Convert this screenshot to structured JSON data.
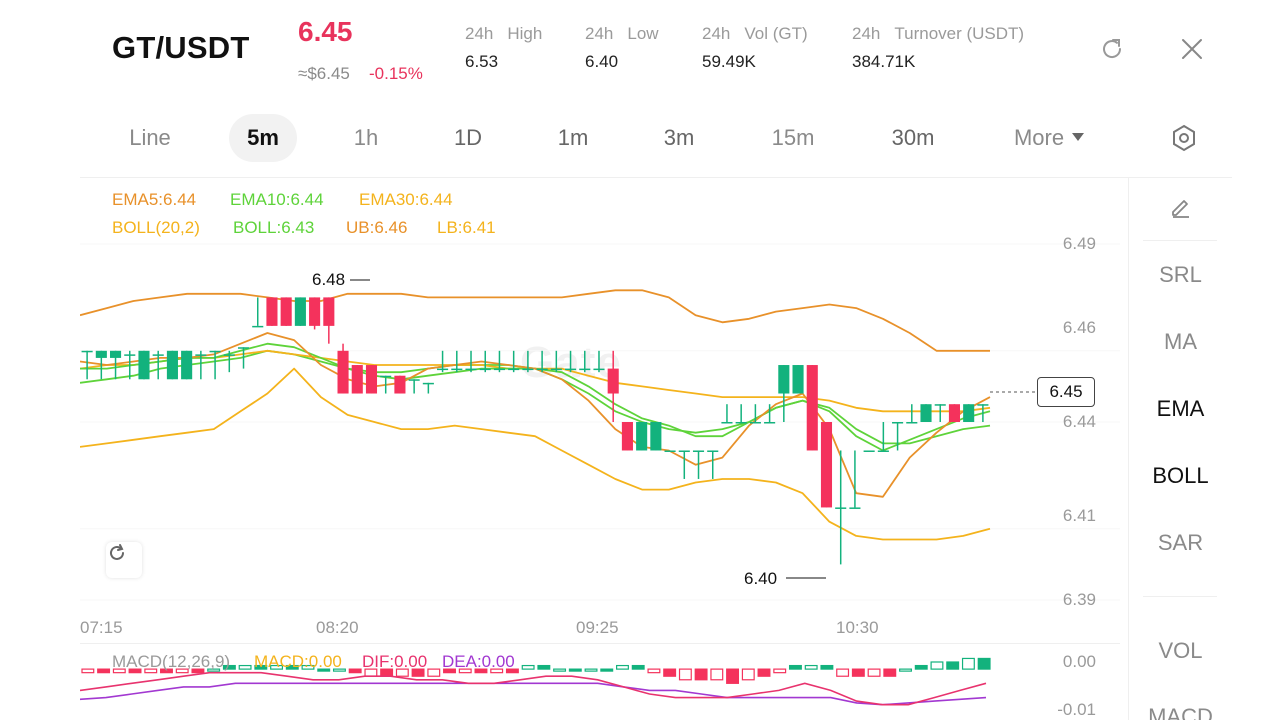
{
  "header": {
    "pair": "GT/USDT",
    "last_price": "6.45",
    "fiat_price": "≈$6.45",
    "change_pct": "-0.15%",
    "stats": [
      {
        "prefix": "24h",
        "label": "High",
        "value": "6.53"
      },
      {
        "prefix": "24h",
        "label": "Low",
        "value": "6.40"
      },
      {
        "prefix": "24h",
        "label": "Vol (GT)",
        "value": "59.49K"
      },
      {
        "prefix": "24h",
        "label": "Turnover (USDT)",
        "value": "384.71K"
      }
    ]
  },
  "timeframes": {
    "items": [
      "Line",
      "5m",
      "1h",
      "1D",
      "1m",
      "3m",
      "15m",
      "30m"
    ],
    "active": "5m",
    "more_label": "More"
  },
  "indicators": {
    "ema": {
      "ema5": "EMA5:6.44",
      "ema10": "EMA10:6.44",
      "ema30": "EMA30:6.44"
    },
    "boll": {
      "params": "BOLL(20,2)",
      "mid": "BOLL:6.43",
      "ub": "UB:6.46",
      "lb": "LB:6.41"
    },
    "macd": {
      "params": "MACD(12,26,9)",
      "macd": "MACD:0.00",
      "dif": "DIF:0.00",
      "dea": "DEA:0.00"
    }
  },
  "right_panel": {
    "items": [
      "SRL",
      "MA",
      "EMA",
      "BOLL",
      "SAR",
      "VOL",
      "MACD"
    ],
    "active": [
      "EMA",
      "BOLL"
    ]
  },
  "colors": {
    "up": "#13b27d",
    "down": "#f4325c",
    "ema5": "#e8912a",
    "ema10": "#5ed33a",
    "ema30": "#f4b31c",
    "boll_mid": "#5ed33a",
    "boll_ub": "#e8912a",
    "boll_lb": "#f4b31c",
    "dif": "#e8336e",
    "dea": "#a238d1"
  },
  "watermark": "Gate",
  "chart_data": {
    "type": "candlestick",
    "time_labels": [
      "07:15",
      "08:20",
      "09:25",
      "10:30"
    ],
    "y_ticks": [
      "6.49",
      "6.46",
      "6.44",
      "6.41",
      "6.39"
    ],
    "macd_ticks": [
      "0.00",
      "-0.01"
    ],
    "last_price": "6.45",
    "annotations": {
      "high": "6.48",
      "low": "6.40"
    },
    "candles": [
      {
        "o": 6.46,
        "c": 6.46,
        "h": 6.46,
        "l": 6.452
      },
      {
        "o": 6.458,
        "c": 6.46,
        "h": 6.46,
        "l": 6.452
      },
      {
        "o": 6.458,
        "c": 6.46,
        "h": 6.46,
        "l": 6.452
      },
      {
        "o": 6.459,
        "c": 6.459,
        "h": 6.46,
        "l": 6.452
      },
      {
        "o": 6.452,
        "c": 6.46,
        "h": 6.46,
        "l": 6.452
      },
      {
        "o": 6.459,
        "c": 6.459,
        "h": 6.46,
        "l": 6.452
      },
      {
        "o": 6.452,
        "c": 6.46,
        "h": 6.46,
        "l": 6.452
      },
      {
        "o": 6.452,
        "c": 6.46,
        "h": 6.46,
        "l": 6.452
      },
      {
        "o": 6.459,
        "c": 6.459,
        "h": 6.46,
        "l": 6.452
      },
      {
        "o": 6.46,
        "c": 6.46,
        "h": 6.46,
        "l": 6.452
      },
      {
        "o": 6.459,
        "c": 6.459,
        "h": 6.46,
        "l": 6.454
      },
      {
        "o": 6.461,
        "c": 6.461,
        "h": 6.461,
        "l": 6.455
      },
      {
        "o": 6.467,
        "c": 6.467,
        "h": 6.475,
        "l": 6.467
      },
      {
        "o": 6.475,
        "c": 6.467,
        "h": 6.475,
        "l": 6.467
      },
      {
        "o": 6.475,
        "c": 6.467,
        "h": 6.475,
        "l": 6.467
      },
      {
        "o": 6.467,
        "c": 6.475,
        "h": 6.475,
        "l": 6.467
      },
      {
        "o": 6.475,
        "c": 6.467,
        "h": 6.475,
        "l": 6.466
      },
      {
        "o": 6.475,
        "c": 6.467,
        "h": 6.475,
        "l": 6.462
      },
      {
        "o": 6.46,
        "c": 6.448,
        "h": 6.462,
        "l": 6.448
      },
      {
        "o": 6.456,
        "c": 6.448,
        "h": 6.456,
        "l": 6.448
      },
      {
        "o": 6.456,
        "c": 6.448,
        "h": 6.456,
        "l": 6.448
      },
      {
        "o": 6.453,
        "c": 6.453,
        "h": 6.453,
        "l": 6.448
      },
      {
        "o": 6.453,
        "c": 6.448,
        "h": 6.453,
        "l": 6.448
      },
      {
        "o": 6.452,
        "c": 6.452,
        "h": 6.452,
        "l": 6.448
      },
      {
        "o": 6.451,
        "c": 6.451,
        "h": 6.451,
        "l": 6.448
      },
      {
        "o": 6.455,
        "c": 6.455,
        "h": 6.46,
        "l": 6.454
      },
      {
        "o": 6.455,
        "c": 6.455,
        "h": 6.46,
        "l": 6.454
      },
      {
        "o": 6.455,
        "c": 6.455,
        "h": 6.46,
        "l": 6.454
      },
      {
        "o": 6.455,
        "c": 6.455,
        "h": 6.46,
        "l": 6.454
      },
      {
        "o": 6.455,
        "c": 6.455,
        "h": 6.46,
        "l": 6.454
      },
      {
        "o": 6.455,
        "c": 6.455,
        "h": 6.46,
        "l": 6.454
      },
      {
        "o": 6.455,
        "c": 6.455,
        "h": 6.46,
        "l": 6.454
      },
      {
        "o": 6.455,
        "c": 6.455,
        "h": 6.46,
        "l": 6.454
      },
      {
        "o": 6.455,
        "c": 6.455,
        "h": 6.46,
        "l": 6.454
      },
      {
        "o": 6.455,
        "c": 6.455,
        "h": 6.46,
        "l": 6.454
      },
      {
        "o": 6.455,
        "c": 6.455,
        "h": 6.46,
        "l": 6.454
      },
      {
        "o": 6.455,
        "c": 6.455,
        "h": 6.46,
        "l": 6.454
      },
      {
        "o": 6.455,
        "c": 6.448,
        "h": 6.46,
        "l": 6.44
      },
      {
        "o": 6.44,
        "c": 6.432,
        "h": 6.44,
        "l": 6.432
      },
      {
        "o": 6.432,
        "c": 6.44,
        "h": 6.44,
        "l": 6.432
      },
      {
        "o": 6.432,
        "c": 6.44,
        "h": 6.44,
        "l": 6.432
      },
      {
        "o": 6.432,
        "c": 6.432,
        "h": 6.432,
        "l": 6.432
      },
      {
        "o": 6.432,
        "c": 6.432,
        "h": 6.432,
        "l": 6.424
      },
      {
        "o": 6.432,
        "c": 6.432,
        "h": 6.432,
        "l": 6.424
      },
      {
        "o": 6.432,
        "c": 6.432,
        "h": 6.432,
        "l": 6.424
      },
      {
        "o": 6.44,
        "c": 6.44,
        "h": 6.445,
        "l": 6.44
      },
      {
        "o": 6.44,
        "c": 6.44,
        "h": 6.445,
        "l": 6.44
      },
      {
        "o": 6.44,
        "c": 6.44,
        "h": 6.445,
        "l": 6.44
      },
      {
        "o": 6.44,
        "c": 6.44,
        "h": 6.445,
        "l": 6.44
      },
      {
        "o": 6.448,
        "c": 6.456,
        "h": 6.456,
        "l": 6.44
      },
      {
        "o": 6.448,
        "c": 6.456,
        "h": 6.456,
        "l": 6.448
      },
      {
        "o": 6.456,
        "c": 6.432,
        "h": 6.456,
        "l": 6.432
      },
      {
        "o": 6.44,
        "c": 6.416,
        "h": 6.44,
        "l": 6.416
      },
      {
        "o": 6.416,
        "c": 6.416,
        "h": 6.432,
        "l": 6.4
      },
      {
        "o": 6.416,
        "c": 6.416,
        "h": 6.432,
        "l": 6.416
      },
      {
        "o": 6.432,
        "c": 6.432,
        "h": 6.432,
        "l": 6.432
      },
      {
        "o": 6.432,
        "c": 6.432,
        "h": 6.44,
        "l": 6.432
      },
      {
        "o": 6.44,
        "c": 6.44,
        "h": 6.44,
        "l": 6.432
      },
      {
        "o": 6.44,
        "c": 6.44,
        "h": 6.445,
        "l": 6.44
      },
      {
        "o": 6.44,
        "c": 6.445,
        "h": 6.445,
        "l": 6.44
      },
      {
        "o": 6.445,
        "c": 6.445,
        "h": 6.445,
        "l": 6.44
      },
      {
        "o": 6.445,
        "c": 6.44,
        "h": 6.445,
        "l": 6.44
      },
      {
        "o": 6.44,
        "c": 6.445,
        "h": 6.445,
        "l": 6.44
      },
      {
        "o": 6.445,
        "c": 6.445,
        "h": 6.445,
        "l": 6.44
      }
    ],
    "ema5": [
      6.457,
      6.456,
      6.457,
      6.458,
      6.458,
      6.459,
      6.462,
      6.465,
      6.463,
      6.456,
      6.452,
      6.45,
      6.451,
      6.455,
      6.456,
      6.457,
      6.456,
      6.455,
      6.452,
      6.446,
      6.438,
      6.433,
      6.432,
      6.428,
      6.43,
      6.439,
      6.445,
      6.448,
      6.438,
      6.42,
      6.419,
      6.43,
      6.437,
      6.443,
      6.447
    ],
    "ema10": [
      6.455,
      6.455,
      6.456,
      6.457,
      6.458,
      6.458,
      6.46,
      6.462,
      6.461,
      6.458,
      6.455,
      6.453,
      6.452,
      6.453,
      6.454,
      6.455,
      6.455,
      6.455,
      6.454,
      6.45,
      6.445,
      6.441,
      6.439,
      6.436,
      6.436,
      6.44,
      6.444,
      6.446,
      6.443,
      6.436,
      6.432,
      6.435,
      6.438,
      6.441,
      6.443
    ],
    "ema30": [
      6.455,
      6.456,
      6.456,
      6.457,
      6.458,
      6.458,
      6.459,
      6.46,
      6.459,
      6.458,
      6.457,
      6.456,
      6.456,
      6.456,
      6.456,
      6.456,
      6.455,
      6.455,
      6.455,
      6.453,
      6.451,
      6.45,
      6.449,
      6.448,
      6.447,
      6.447,
      6.447,
      6.447,
      6.446,
      6.444,
      6.443,
      6.443,
      6.443,
      6.443,
      6.444
    ],
    "boll_mid": [
      6.451,
      6.452,
      6.453,
      6.455,
      6.456,
      6.457,
      6.458,
      6.46,
      6.459,
      6.457,
      6.455,
      6.454,
      6.454,
      6.455,
      6.456,
      6.456,
      6.456,
      6.455,
      6.452,
      6.448,
      6.443,
      6.44,
      6.438,
      6.437,
      6.438,
      6.44,
      6.444,
      6.446,
      6.444,
      6.438,
      6.434,
      6.434,
      6.436,
      6.438,
      6.439
    ],
    "boll_ub": [
      6.47,
      6.472,
      6.474,
      6.475,
      6.476,
      6.476,
      6.476,
      6.475,
      6.474,
      6.474,
      6.476,
      6.476,
      6.476,
      6.475,
      6.475,
      6.475,
      6.475,
      6.475,
      6.475,
      6.476,
      6.477,
      6.477,
      6.475,
      6.47,
      6.468,
      6.469,
      6.471,
      6.472,
      6.473,
      6.472,
      6.469,
      6.465,
      6.46,
      6.46,
      6.46
    ],
    "boll_lb": [
      6.433,
      6.434,
      6.435,
      6.436,
      6.437,
      6.438,
      6.443,
      6.448,
      6.455,
      6.447,
      6.442,
      6.44,
      6.438,
      6.438,
      6.439,
      6.438,
      6.437,
      6.436,
      6.432,
      6.428,
      6.424,
      6.421,
      6.421,
      6.423,
      6.424,
      6.424,
      6.423,
      6.42,
      6.412,
      6.408,
      6.407,
      6.407,
      6.407,
      6.408,
      6.41
    ],
    "macd_hist": [
      -0.001,
      -0.001,
      -0.001,
      -0.001,
      -0.001,
      -0.001,
      -0.001,
      -0.001,
      0.0,
      0.001,
      0.001,
      0.001,
      0.001,
      0.001,
      0.001,
      0.0,
      0.0,
      -0.001,
      -0.002,
      -0.002,
      -0.002,
      -0.002,
      -0.002,
      -0.001,
      -0.001,
      -0.001,
      -0.001,
      -0.001,
      0.001,
      0.001,
      0.0,
      0.0,
      0.0,
      0.0,
      0.001,
      0.001,
      -0.001,
      -0.002,
      -0.003,
      -0.003,
      -0.003,
      -0.004,
      -0.003,
      -0.002,
      -0.001,
      0.001,
      0.001,
      0.001,
      -0.002,
      -0.002,
      -0.002,
      -0.002,
      0.0,
      0.001,
      0.002,
      0.002,
      0.003,
      0.003
    ],
    "dif": [
      -0.006,
      -0.005,
      -0.004,
      -0.003,
      -0.002,
      -0.001,
      -0.001,
      -0.001,
      -0.002,
      -0.003,
      -0.003,
      -0.002,
      -0.002,
      -0.003,
      -0.003,
      -0.004,
      -0.004,
      -0.003,
      -0.002,
      -0.002,
      -0.003,
      -0.005,
      -0.007,
      -0.008,
      -0.008,
      -0.008,
      -0.007,
      -0.006,
      -0.004,
      -0.006,
      -0.009,
      -0.01,
      -0.01,
      -0.008,
      -0.006,
      -0.004
    ],
    "dea": [
      -0.0085,
      -0.008,
      -0.007,
      -0.006,
      -0.005,
      -0.005,
      -0.004,
      -0.004,
      -0.004,
      -0.004,
      -0.004,
      -0.004,
      -0.004,
      -0.004,
      -0.004,
      -0.004,
      -0.004,
      -0.004,
      -0.004,
      -0.004,
      -0.004,
      -0.005,
      -0.006,
      -0.006,
      -0.007,
      -0.008,
      -0.008,
      -0.008,
      -0.008,
      -0.008,
      -0.0095,
      -0.01,
      -0.0095,
      -0.009,
      -0.0085,
      -0.008
    ]
  }
}
